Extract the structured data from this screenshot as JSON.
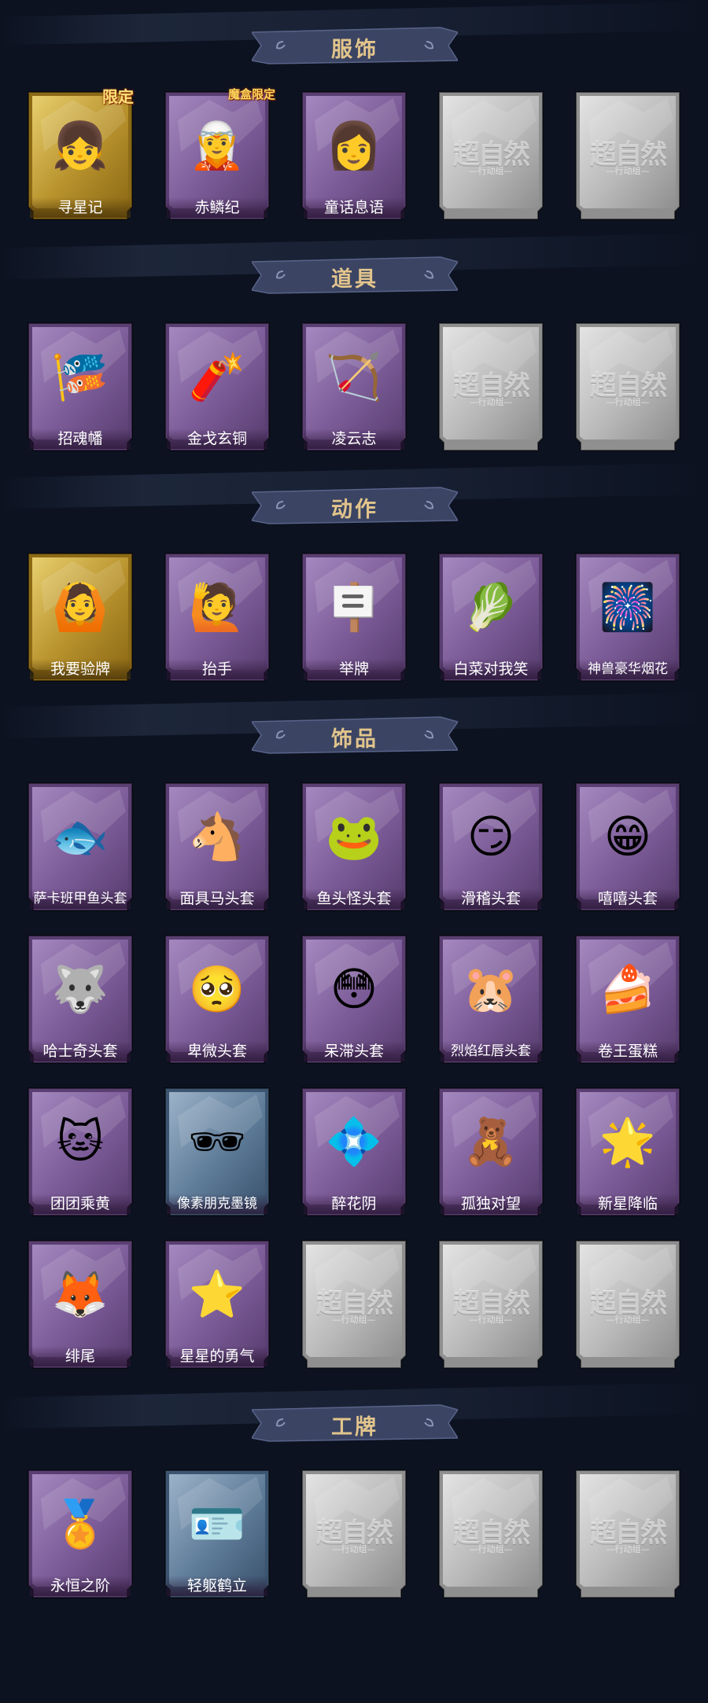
{
  "colors": {
    "background": "#0c1220",
    "banner": "#3b4463",
    "banner_text": "#e2c58c",
    "card_purple": "#8e6ea8",
    "card_gold": "#c9a63a",
    "card_blue": "#6a8aa8",
    "card_empty": "#c9c9c9"
  },
  "empty_watermark": {
    "title": "超自然",
    "subtitle": "—行动组—"
  },
  "sections": {
    "clothing": {
      "title": "服饰",
      "items": [
        {
          "label": "寻星记",
          "tag": "限定",
          "style": "gold",
          "icon": "star-hero-costume-icon"
        },
        {
          "label": "赤鳞纪",
          "tag": "魔盒限定",
          "style": "purple",
          "icon": "dragon-girl-costume-icon"
        },
        {
          "label": "童话息语",
          "style": "purple",
          "icon": "fairytale-girl-costume-icon"
        }
      ]
    },
    "props": {
      "title": "道具",
      "items": [
        {
          "label": "招魂幡",
          "style": "purple",
          "icon": "spirit-banner-icon"
        },
        {
          "label": "金戈玄铜",
          "style": "purple",
          "icon": "bronze-grenade-icon"
        },
        {
          "label": "凌云志",
          "style": "purple",
          "icon": "crossbow-icon"
        }
      ]
    },
    "actions": {
      "title": "动作",
      "items": [
        {
          "label": "我要验牌",
          "style": "gold",
          "icon": "check-cards-pose-icon"
        },
        {
          "label": "抬手",
          "style": "purple",
          "icon": "raise-hand-pose-icon"
        },
        {
          "label": "举牌",
          "style": "purple",
          "icon": "hold-sign-pose-icon"
        },
        {
          "label": "白菜对我笑",
          "style": "purple",
          "icon": "cabbage-smile-pose-icon"
        },
        {
          "label": "神兽豪华烟花",
          "style": "purple",
          "icon": "fireworks-pose-icon"
        }
      ]
    },
    "accessories": {
      "title": "饰品",
      "items": [
        {
          "label": "萨卡班甲鱼头套",
          "style": "purple",
          "icon": "fish-head-icon"
        },
        {
          "label": "面具马头套",
          "style": "purple",
          "icon": "horse-mask-icon"
        },
        {
          "label": "鱼头怪头套",
          "style": "purple",
          "icon": "green-fish-mask-icon"
        },
        {
          "label": "滑稽头套",
          "style": "purple",
          "icon": "funny-face-mask-icon"
        },
        {
          "label": "嘻嘻头套",
          "style": "purple",
          "icon": "grin-face-mask-icon"
        },
        {
          "label": "哈士奇头套",
          "style": "purple",
          "icon": "husky-mask-icon"
        },
        {
          "label": "卑微头套",
          "style": "purple",
          "icon": "humble-face-mask-icon"
        },
        {
          "label": "呆滞头套",
          "style": "purple",
          "icon": "dazed-face-mask-icon"
        },
        {
          "label": "烈焰红唇头套",
          "style": "purple",
          "icon": "pikachu-lips-mask-icon"
        },
        {
          "label": "卷王蛋糕",
          "style": "purple",
          "icon": "roll-cake-icon"
        },
        {
          "label": "团团乘黄",
          "style": "purple",
          "icon": "fluffy-beast-icon"
        },
        {
          "label": "像素朋克墨镜",
          "style": "blue",
          "icon": "pixel-sunglasses-icon"
        },
        {
          "label": "醉花阴",
          "style": "purple",
          "icon": "flower-ornament-icon"
        },
        {
          "label": "孤独对望",
          "style": "purple",
          "icon": "keychain-figure-icon"
        },
        {
          "label": "新星降临",
          "style": "purple",
          "icon": "keychain-star-figure-icon"
        },
        {
          "label": "绯尾",
          "style": "purple",
          "icon": "fox-tail-keychain-icon"
        },
        {
          "label": "星星的勇气",
          "style": "purple",
          "icon": "star-courage-keychain-icon"
        }
      ]
    },
    "badges": {
      "title": "工牌",
      "items": [
        {
          "label": "永恒之阶",
          "style": "purple",
          "icon": "golden-badge-icon"
        },
        {
          "label": "轻躯鹤立",
          "style": "blue",
          "icon": "silhouette-card-icon"
        }
      ]
    }
  }
}
